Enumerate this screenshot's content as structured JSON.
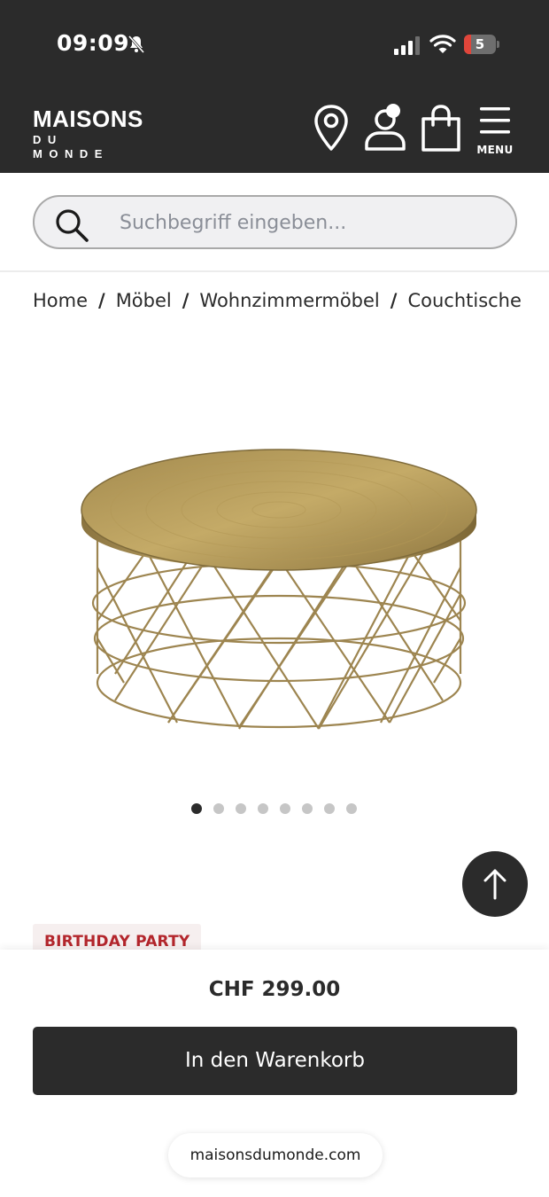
{
  "status_bar": {
    "time": "09:09",
    "battery_level": "5",
    "colors": {
      "battery_low": "#e0453a"
    }
  },
  "header": {
    "logo": {
      "line1": "MAISONS",
      "line2": "DU MONDE"
    },
    "menu_label": "MENU",
    "icons": [
      "location-pin-icon",
      "account-icon",
      "shopping-bag-icon",
      "hamburger-menu-icon"
    ],
    "background": "#2b2b2b"
  },
  "search": {
    "placeholder": "Suchbegriff eingeben...",
    "value": ""
  },
  "breadcrumb": [
    "Home",
    "Möbel",
    "Wohnzimmermöbel",
    "Couchtische"
  ],
  "breadcrumb_separator": "/",
  "gallery": {
    "image": "gold-round-hammered-coffee-table",
    "slide_count": 8,
    "active_slide": 1
  },
  "product": {
    "badge": "BIRTHDAY PARTY",
    "price": "CHF 299.00",
    "badge_color": "#b3262c"
  },
  "cart_button": {
    "label": "In den Warenkorb"
  },
  "browser": {
    "url": "maisonsdumonde.com"
  }
}
